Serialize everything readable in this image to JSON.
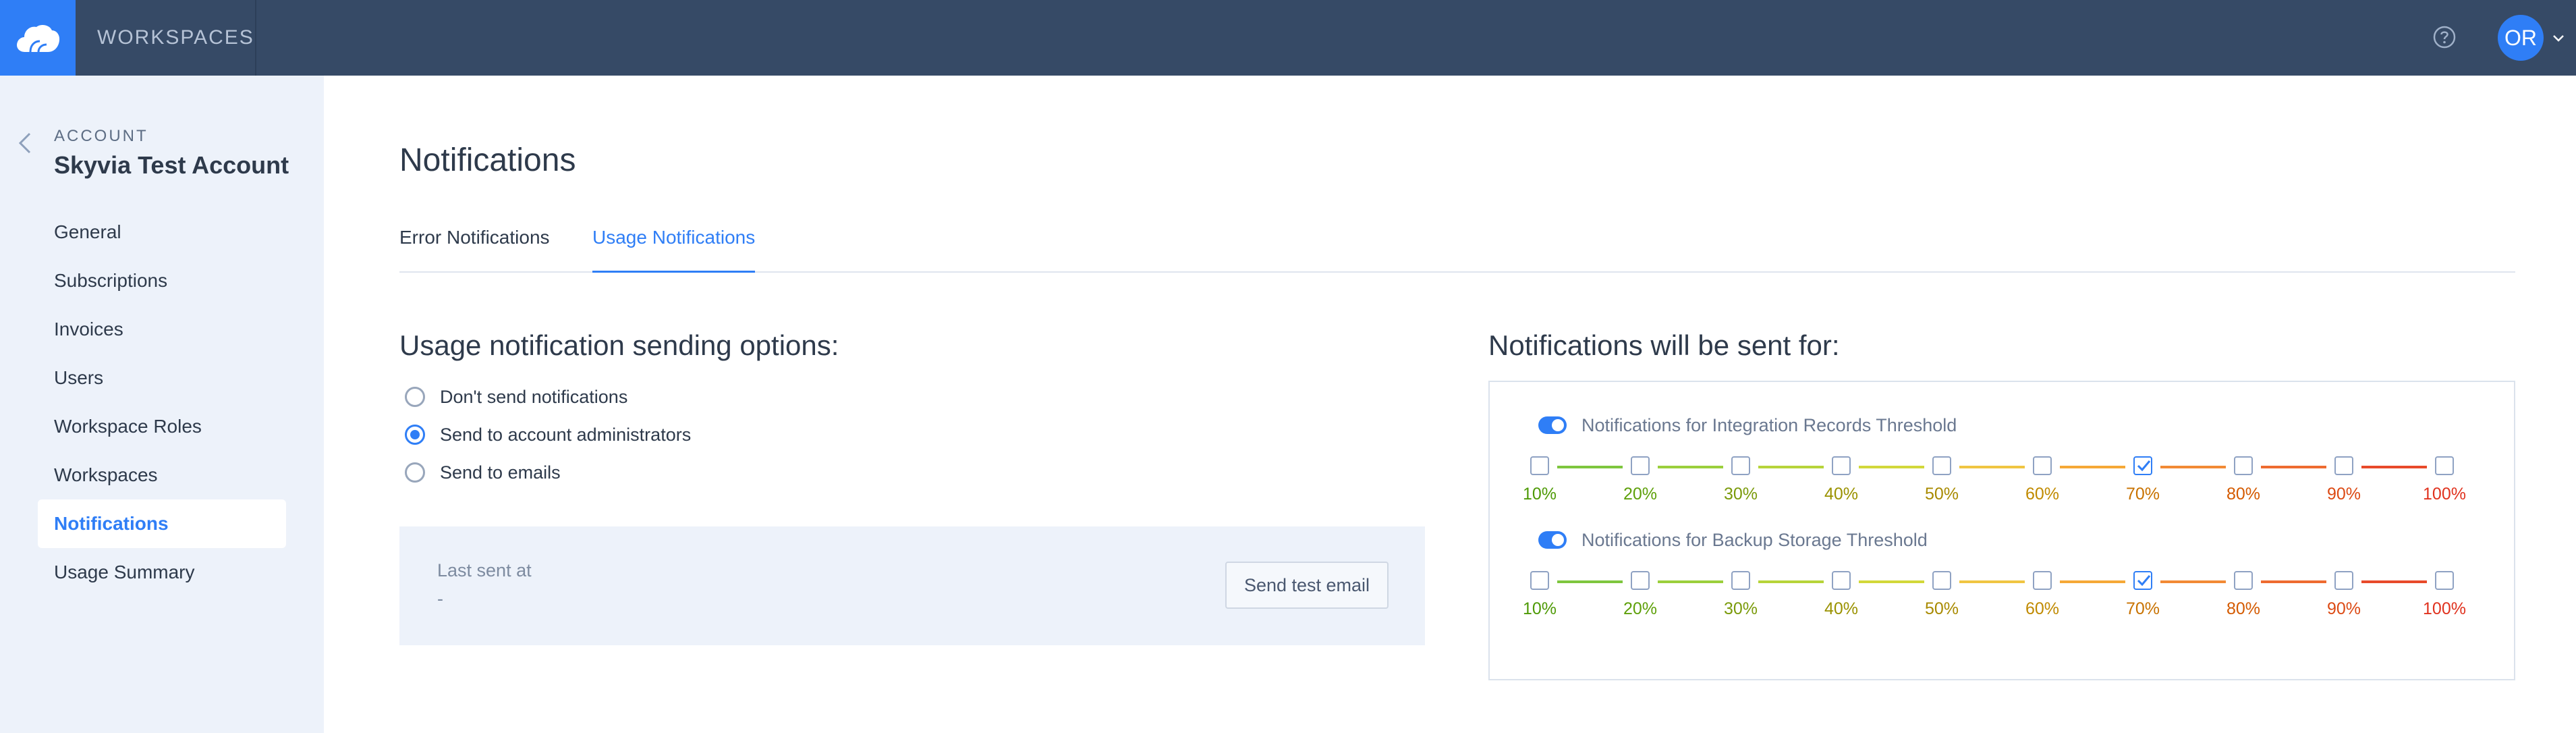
{
  "topbar": {
    "workspaces_label": "WORKSPACES",
    "avatar_initials": "OR"
  },
  "sidebar": {
    "section_label": "ACCOUNT",
    "account_name": "Skyvia Test Account",
    "items": [
      {
        "label": "General",
        "active": false
      },
      {
        "label": "Subscriptions",
        "active": false
      },
      {
        "label": "Invoices",
        "active": false
      },
      {
        "label": "Users",
        "active": false
      },
      {
        "label": "Workspace Roles",
        "active": false
      },
      {
        "label": "Workspaces",
        "active": false
      },
      {
        "label": "Notifications",
        "active": true
      },
      {
        "label": "Usage Summary",
        "active": false
      }
    ]
  },
  "page": {
    "title": "Notifications",
    "tabs": [
      {
        "label": "Error Notifications",
        "active": false
      },
      {
        "label": "Usage Notifications",
        "active": true
      }
    ]
  },
  "options": {
    "heading": "Usage notification sending options:",
    "radios": [
      {
        "label": "Don't send notifications",
        "checked": false
      },
      {
        "label": "Send to account administrators",
        "checked": true
      },
      {
        "label": "Send to emails",
        "checked": false
      }
    ],
    "last_sent_label": "Last sent at",
    "last_sent_value": "-",
    "test_button": "Send test email"
  },
  "thresholds": {
    "heading": "Notifications will be sent for:",
    "levels": [
      {
        "label": "10%",
        "color": "#4e9a06"
      },
      {
        "label": "20%",
        "color": "#5ea00a"
      },
      {
        "label": "30%",
        "color": "#7a9a0a"
      },
      {
        "label": "40%",
        "color": "#9a9200"
      },
      {
        "label": "50%",
        "color": "#a88a00"
      },
      {
        "label": "60%",
        "color": "#c08a00"
      },
      {
        "label": "70%",
        "color": "#c87200"
      },
      {
        "label": "80%",
        "color": "#d45a00"
      },
      {
        "label": "90%",
        "color": "#dc4a14"
      },
      {
        "label": "100%",
        "color": "#e0321e"
      }
    ],
    "segment_colors": [
      "#7ec63e",
      "#9bcf3c",
      "#b7d43a",
      "#d2d83a",
      "#f0c542",
      "#f5a837",
      "#f28a35",
      "#ee6b30",
      "#e84a2a"
    ],
    "groups": [
      {
        "title": "Notifications for Integration Records Threshold",
        "enabled": true,
        "checked_index": 6
      },
      {
        "title": "Notifications for Backup Storage Threshold",
        "enabled": true,
        "checked_index": 6
      }
    ]
  }
}
